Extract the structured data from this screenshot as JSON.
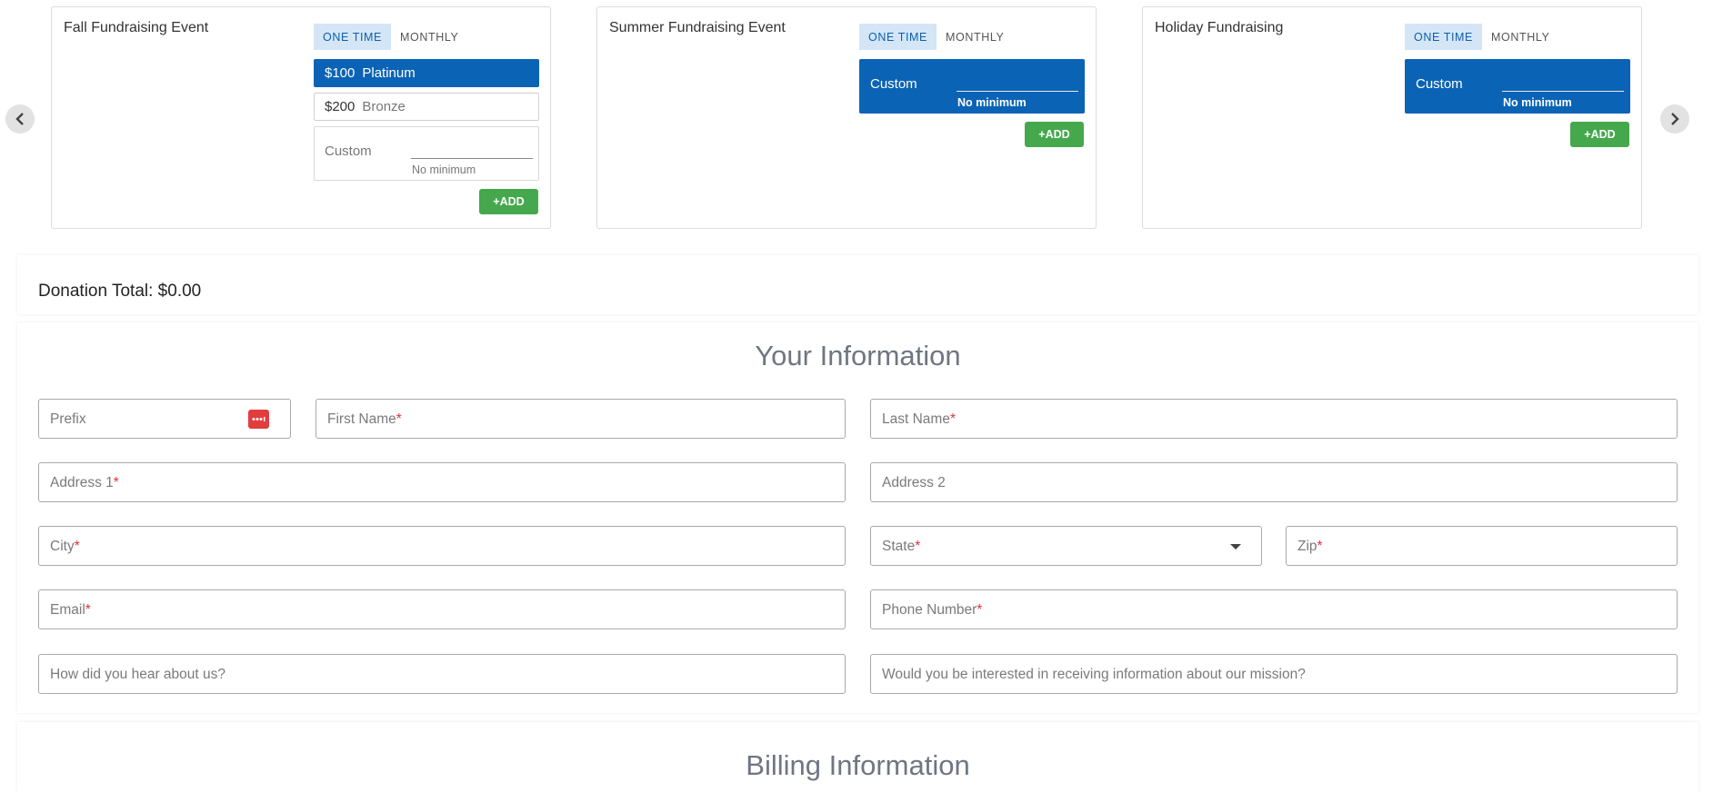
{
  "carousel": {
    "cards": [
      {
        "title": "Fall Fundraising Event",
        "tabs": [
          "ONE TIME",
          "MONTHLY"
        ],
        "levels": [
          {
            "amount": "$100",
            "name": "Platinum"
          },
          {
            "amount": "$200",
            "name": "Bronze"
          }
        ],
        "custom_label": "Custom",
        "custom_note": "No minimum",
        "add_label": "+ADD"
      },
      {
        "title": "Summer Fundraising Event",
        "tabs": [
          "ONE TIME",
          "MONTHLY"
        ],
        "custom_label": "Custom",
        "custom_note": "No minimum",
        "add_label": "+ADD"
      },
      {
        "title": "Holiday Fundraising",
        "tabs": [
          "ONE TIME",
          "MONTHLY"
        ],
        "custom_label": "Custom",
        "custom_note": "No minimum",
        "add_label": "+ADD"
      }
    ],
    "prev_icon": "chevron-left-icon",
    "next_icon": "chevron-right-icon"
  },
  "donation_total": "Donation Total: $0.00",
  "your_information": {
    "title": "Your Information",
    "fields": {
      "prefix": "Prefix",
      "first_name": "First Name",
      "last_name": "Last Name",
      "address1": "Address 1",
      "address2": "Address 2",
      "city": "City",
      "state": "State",
      "zip": "Zip",
      "email": "Email",
      "phone": "Phone Number",
      "hear_about": "How did you hear about us?",
      "mission_info": "Would you be interested in receiving information about our mission?"
    },
    "required_marker": "*"
  },
  "billing_information": {
    "title": "Billing Information"
  },
  "colors": {
    "accent_blue": "#0b63b5",
    "tab_active_bg": "#d4e6f6",
    "add_green": "#45a84d",
    "required_red": "#e0303a",
    "heading_gray": "#6f7582"
  }
}
